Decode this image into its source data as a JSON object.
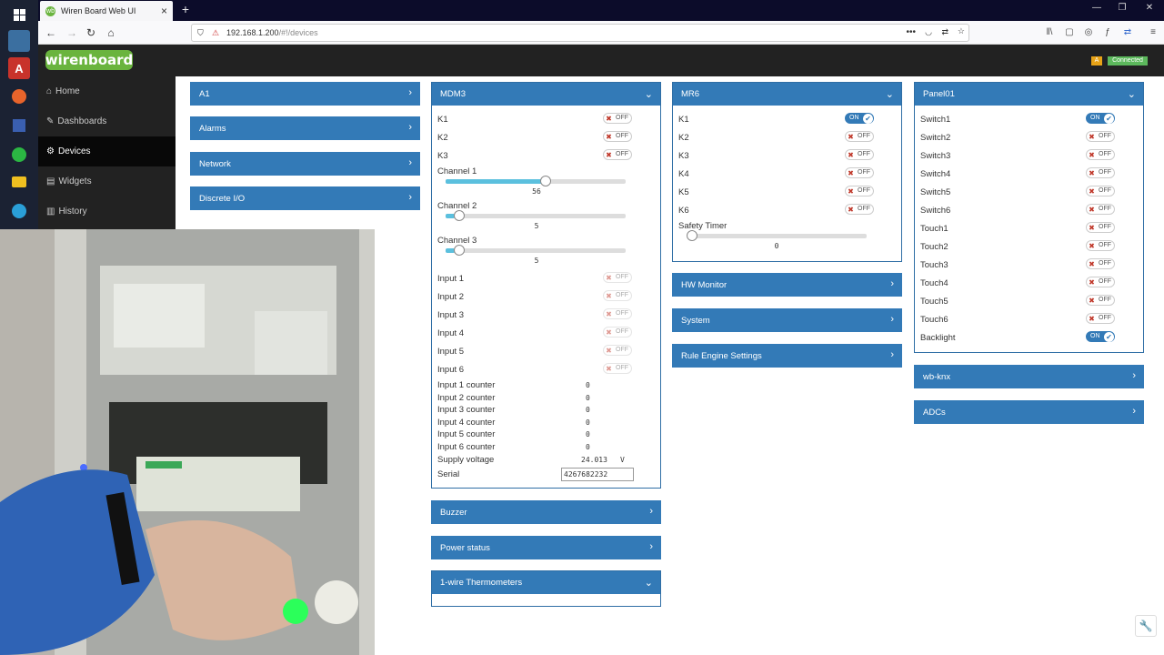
{
  "browser": {
    "tab_title": "Wiren Board Web UI",
    "tab_favicon": "wb",
    "url_host": "192.168.1.200",
    "url_path": "/#!/devices"
  },
  "header": {
    "logo": "wirenboard",
    "badge": "A",
    "status": "Connected"
  },
  "sidebar": {
    "items": [
      {
        "label": "Home",
        "icon": "home-icon"
      },
      {
        "label": "Dashboards",
        "icon": "wrench-icon"
      },
      {
        "label": "Devices",
        "icon": "gear-icon",
        "active": true
      },
      {
        "label": "Widgets",
        "icon": "list-icon"
      },
      {
        "label": "History",
        "icon": "bar-chart-icon"
      }
    ]
  },
  "col1": {
    "buttons": [
      "A1",
      "Alarms",
      "Network",
      "Discrete I/O"
    ]
  },
  "mdm3": {
    "title": "MDM3",
    "k": [
      {
        "label": "K1",
        "state": "OFF"
      },
      {
        "label": "K2",
        "state": "OFF"
      },
      {
        "label": "K3",
        "state": "OFF"
      }
    ],
    "channels": [
      {
        "label": "Channel 1",
        "value": "56",
        "level": 0.56
      },
      {
        "label": "Channel 2",
        "value": "5",
        "level": 0.05
      },
      {
        "label": "Channel 3",
        "value": "5",
        "level": 0.05
      }
    ],
    "inputs": [
      {
        "label": "Input 1",
        "state": "OFF"
      },
      {
        "label": "Input 2",
        "state": "OFF"
      },
      {
        "label": "Input 3",
        "state": "OFF"
      },
      {
        "label": "Input 4",
        "state": "OFF"
      },
      {
        "label": "Input 5",
        "state": "OFF"
      },
      {
        "label": "Input 6",
        "state": "OFF"
      }
    ],
    "counters": [
      {
        "label": "Input 1 counter",
        "value": "0"
      },
      {
        "label": "Input 2 counter",
        "value": "0"
      },
      {
        "label": "Input 3 counter",
        "value": "0"
      },
      {
        "label": "Input 4 counter",
        "value": "0"
      },
      {
        "label": "Input 5 counter",
        "value": "0"
      },
      {
        "label": "Input 6 counter",
        "value": "0"
      }
    ],
    "supply_label": "Supply voltage",
    "supply_value": "24.013",
    "supply_unit": "V",
    "serial_label": "Serial",
    "serial_value": "4267682232"
  },
  "col2_buttons": [
    "Buzzer",
    "Power status"
  ],
  "thermo": {
    "title": "1-wire Thermometers"
  },
  "mr6": {
    "title": "MR6",
    "k": [
      {
        "label": "K1",
        "state": "ON"
      },
      {
        "label": "K2",
        "state": "OFF"
      },
      {
        "label": "K3",
        "state": "OFF"
      },
      {
        "label": "K4",
        "state": "OFF"
      },
      {
        "label": "K5",
        "state": "OFF"
      },
      {
        "label": "K6",
        "state": "OFF"
      }
    ],
    "timer_label": "Safety Timer",
    "timer_value": "0",
    "timer_level": 0
  },
  "col3_buttons": [
    "HW Monitor",
    "System",
    "Rule Engine Settings"
  ],
  "panel01": {
    "title": "Panel01",
    "items": [
      {
        "label": "Switch1",
        "state": "ON"
      },
      {
        "label": "Switch2",
        "state": "OFF"
      },
      {
        "label": "Switch3",
        "state": "OFF"
      },
      {
        "label": "Switch4",
        "state": "OFF"
      },
      {
        "label": "Switch5",
        "state": "OFF"
      },
      {
        "label": "Switch6",
        "state": "OFF"
      },
      {
        "label": "Touch1",
        "state": "OFF"
      },
      {
        "label": "Touch2",
        "state": "OFF"
      },
      {
        "label": "Touch3",
        "state": "OFF"
      },
      {
        "label": "Touch4",
        "state": "OFF"
      },
      {
        "label": "Touch5",
        "state": "OFF"
      },
      {
        "label": "Touch6",
        "state": "OFF"
      },
      {
        "label": "Backlight",
        "state": "ON"
      }
    ]
  },
  "col4_buttons": [
    "wb-knx",
    "ADCs"
  ],
  "colors": {
    "panel_blue": "#337ab7",
    "brand_green": "#6ab43e",
    "connected_green": "#5cb85c"
  }
}
